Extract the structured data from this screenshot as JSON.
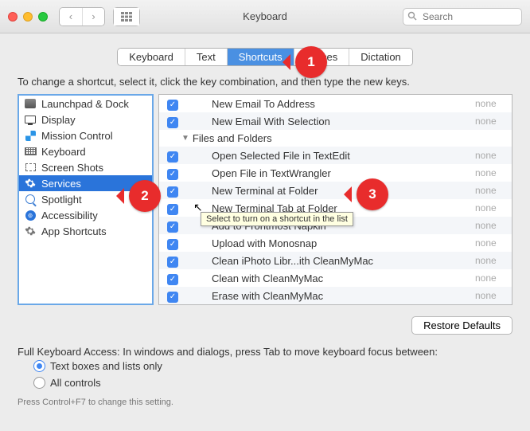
{
  "window": {
    "title": "Keyboard",
    "search_placeholder": "Search"
  },
  "tabs": [
    {
      "label": "Keyboard",
      "active": false
    },
    {
      "label": "Text",
      "active": false
    },
    {
      "label": "Shortcuts",
      "active": true
    },
    {
      "label": "Input Sources",
      "active": false,
      "clipped": "rces"
    },
    {
      "label": "Dictation",
      "active": false
    }
  ],
  "instruction": "To change a shortcut, select it, click the key combination, and then type the new keys.",
  "sidebar": [
    {
      "key": "launchpad",
      "label": "Launchpad & Dock",
      "icon": "launchpad-icon"
    },
    {
      "key": "display",
      "label": "Display",
      "icon": "display-icon"
    },
    {
      "key": "mission",
      "label": "Mission Control",
      "icon": "mission-control-icon"
    },
    {
      "key": "keyboard",
      "label": "Keyboard",
      "icon": "keyboard-icon"
    },
    {
      "key": "screenshots",
      "label": "Screen Shots",
      "icon": "screenshots-icon"
    },
    {
      "key": "services",
      "label": "Services",
      "icon": "gear-icon",
      "active": true
    },
    {
      "key": "spotlight",
      "label": "Spotlight",
      "icon": "spotlight-icon"
    },
    {
      "key": "accessibility",
      "label": "Accessibility",
      "icon": "accessibility-icon"
    },
    {
      "key": "appshortcuts",
      "label": "App Shortcuts",
      "icon": "app-shortcuts-icon"
    }
  ],
  "services": [
    {
      "type": "item",
      "checked": true,
      "label": "New Email To Address",
      "status": "none"
    },
    {
      "type": "item",
      "checked": true,
      "label": "New Email With Selection",
      "status": "none"
    },
    {
      "type": "group",
      "label": "Files and Folders"
    },
    {
      "type": "item",
      "checked": true,
      "label": "Open Selected File in TextEdit",
      "status": "none"
    },
    {
      "type": "item",
      "checked": true,
      "label": "Open File in TextWrangler",
      "status": "none"
    },
    {
      "type": "item",
      "checked": true,
      "label": "New Terminal at Folder",
      "status": "none"
    },
    {
      "type": "item",
      "checked": true,
      "label": "New Terminal Tab at Folder",
      "status": "none"
    },
    {
      "type": "item",
      "checked": true,
      "label": "Add to Frontmost Napkin",
      "status": "none"
    },
    {
      "type": "item",
      "checked": true,
      "label": "Upload with Monosnap",
      "status": "none"
    },
    {
      "type": "item",
      "checked": true,
      "label": "Clean iPhoto Libr...ith CleanMyMac",
      "status": "none"
    },
    {
      "type": "item",
      "checked": true,
      "label": "Clean with CleanMyMac",
      "status": "none"
    },
    {
      "type": "item",
      "checked": true,
      "label": "Erase with CleanMyMac",
      "status": "none"
    }
  ],
  "restore_button": "Restore Defaults",
  "fka": {
    "heading": "Full Keyboard Access: In windows and dialogs, press Tab to move keyboard focus between:",
    "opt1": "Text boxes and lists only",
    "opt2": "All controls",
    "hint": "Press Control+F7 to change this setting."
  },
  "tooltip": "Select to turn on a shortcut in the list",
  "callouts": {
    "c1": "1",
    "c2": "2",
    "c3": "3"
  }
}
